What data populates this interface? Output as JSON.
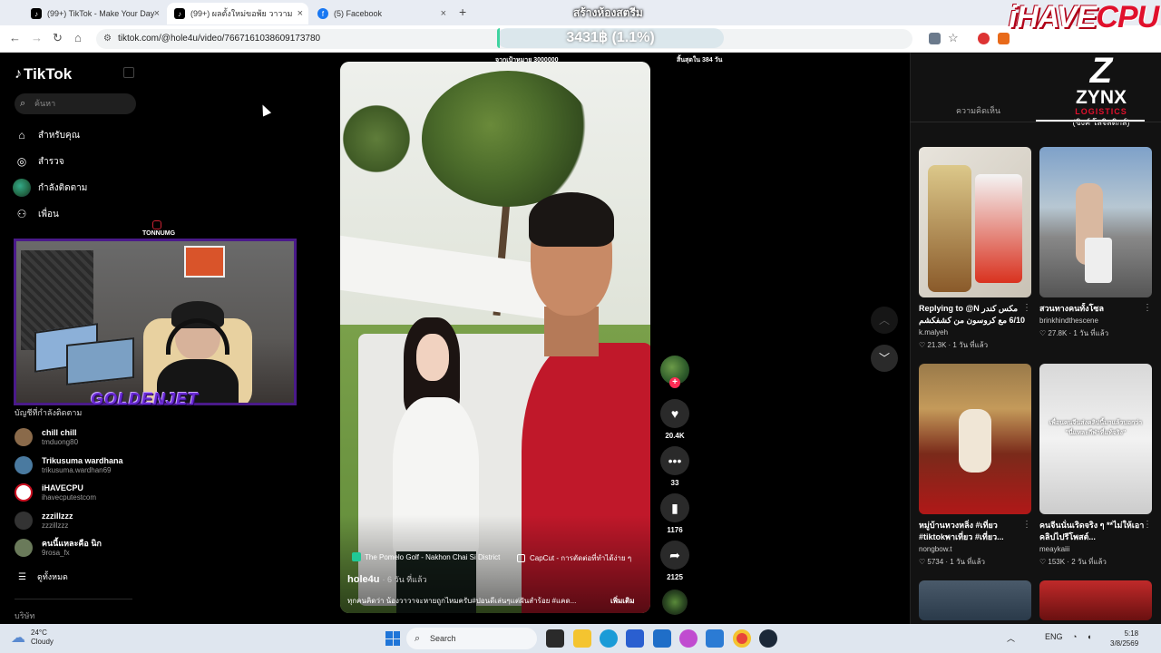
{
  "browser": {
    "tabs": [
      {
        "title": "(99+) TikTok - Make Your Day",
        "icon": "tiktok-icon",
        "active": false
      },
      {
        "title": "(99+) ผลตั้งใหม่ขอพ้ย วาวาม",
        "icon": "tiktok-icon",
        "active": true
      },
      {
        "title": "(5) Facebook",
        "icon": "facebook-icon",
        "active": false
      }
    ],
    "new_tab": "+",
    "url": "tiktok.com/@hole4u/video/7667161038609173780"
  },
  "overlay": {
    "stream_title": "สร้างห้องสตรีม",
    "donation_text": "3431฿ (1.1%)",
    "donation_progress_percent": 1.1,
    "goal_left": "จากเป้าหมาย 3000000",
    "goal_right": "สิ้นสุดใน 384 วัน",
    "brand_logo_white": "iHAVE",
    "brand_logo_red": "CPU",
    "sponsor_letter": "Z",
    "sponsor_name": "ZYNX",
    "sponsor_sub": "LOGISTICS",
    "sponsor_th": "(ซิงค์ โลจิสติกส์)",
    "cam_tag": "TONNUMG",
    "cam_name": "GOLDENJET"
  },
  "sidebar": {
    "logo": "TikTok",
    "search_placeholder": "ค้นหา",
    "nav": [
      {
        "label": "สำหรับคุณ",
        "icon": "home-icon"
      },
      {
        "label": "สำรวจ",
        "icon": "compass-icon"
      },
      {
        "label": "กำลังติดตาม",
        "icon": "following-avatar-icon"
      },
      {
        "label": "เพื่อน",
        "icon": "friends-icon"
      }
    ],
    "following_heading": "บัญชีที่กำลังติดตาม",
    "following": [
      {
        "name": "chill chill",
        "handle": "tmduong80",
        "color": "#8a6a4a"
      },
      {
        "name": "Trikusuma wardhana",
        "handle": "trikusuma.wardhan69",
        "color": "#4a7aa0"
      },
      {
        "name": "iHAVECPU",
        "handle": "ihavecputestcom",
        "color": "#ffffff"
      },
      {
        "name": "zzzillzzz",
        "handle": "zzzillzzz",
        "color": "#333333"
      },
      {
        "name": "คนนี้แหละคือ นิก",
        "handle": "9rosa_fx",
        "color": "#6a7a5a"
      }
    ],
    "see_all": "ดูทั้งหมด",
    "company": "บริษัท"
  },
  "video": {
    "location": "The Pomelo Golf - Nakhon Chai Si District",
    "capcut": "CapCut - การตัดต่อที่ทำได้ง่าย ๆ",
    "author": "hole4u",
    "ago": "· 6 วัน ที่แล้ว",
    "description": "ทุกคนคิดว่า น้องวาวาจะหายถูกไหมครับ#ปอนดีเล่นๆแต่ฝันสำร้อย #แคด...",
    "more": "เพิ่มเติม"
  },
  "actions": {
    "likes": "20.4K",
    "comments": "33",
    "saves": "1176",
    "shares": "2125"
  },
  "right_panel": {
    "tab_comments": "ความคิดเห็น",
    "cards": [
      {
        "caption": "Replying to @N مكس كندر 6/10 مع كروسون من كشفكشم",
        "author": "k.malyeh",
        "meta": "♡ 21.3K · 1 วัน ที่แล้ว",
        "overlay": ""
      },
      {
        "caption": "สวนทางคนทั้งโซล",
        "author": "brinkhindthescene",
        "meta": "♡ 27.8K · 1 วัน ที่แล้ว",
        "overlay": ""
      },
      {
        "caption": "หมู่บ้านหวงหลิ่ง #เที่ยว #tiktokพาเที่ยว #เที่ยว...",
        "author": "nongbow.t",
        "meta": "♡ 5734 · 1 วัน ที่แล้ว",
        "overlay": ""
      },
      {
        "caption": "คนจีนนั่นเริดจริง ๆ **ไม่ให้เอาคลิปไปรีโพสต์...",
        "author": "meaykaiii",
        "meta": "♡ 153K · 2 วัน ที่แล้ว",
        "overlay": "เพื่อนคนจีนส่งคลิปนี้มาแล้วบอกว่า \"นี่แหละกีฬาที่แท้จริง\""
      }
    ]
  },
  "taskbar": {
    "weather_temp": "24°C",
    "weather_desc": "Cloudy",
    "search": "Search",
    "lang": "ENG",
    "time": "5:18",
    "date": "3/8/2569"
  }
}
